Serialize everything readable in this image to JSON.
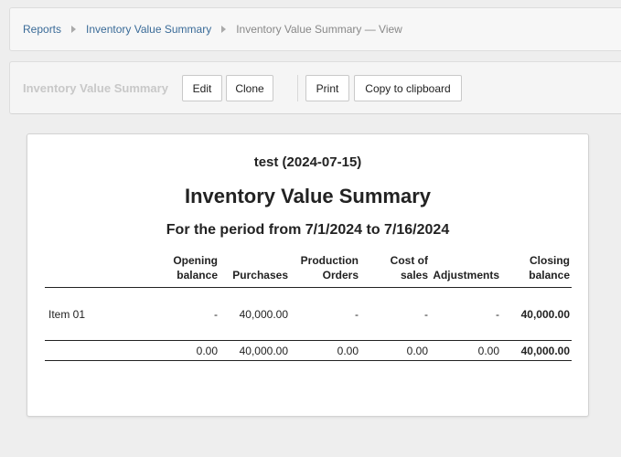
{
  "breadcrumb": {
    "items": [
      "Reports",
      "Inventory Value Summary"
    ],
    "current": "Inventory Value Summary — View"
  },
  "toolbar": {
    "title": "Inventory Value Summary",
    "edit_label": "Edit",
    "clone_label": "Clone",
    "print_label": "Print",
    "copy_label": "Copy to clipboard"
  },
  "report": {
    "company": "test (2024-07-15)",
    "title": "Inventory Value Summary",
    "period": "For the period from 7/1/2024 to 7/16/2024",
    "columns": [
      {
        "line1": "Opening",
        "line2": "balance"
      },
      {
        "line1": "",
        "line2": "Purchases"
      },
      {
        "line1": "Production",
        "line2": "Orders"
      },
      {
        "line1": "Cost of",
        "line2": "sales"
      },
      {
        "line1": "",
        "line2": "Adjustments"
      },
      {
        "line1": "Closing",
        "line2": "balance"
      }
    ],
    "rows": [
      {
        "name": "Item 01",
        "values": [
          "-",
          "40,000.00",
          "-",
          "-",
          "-",
          "40,000.00"
        ]
      }
    ],
    "totals": [
      "0.00",
      "40,000.00",
      "0.00",
      "0.00",
      "0.00",
      "40,000.00"
    ]
  }
}
